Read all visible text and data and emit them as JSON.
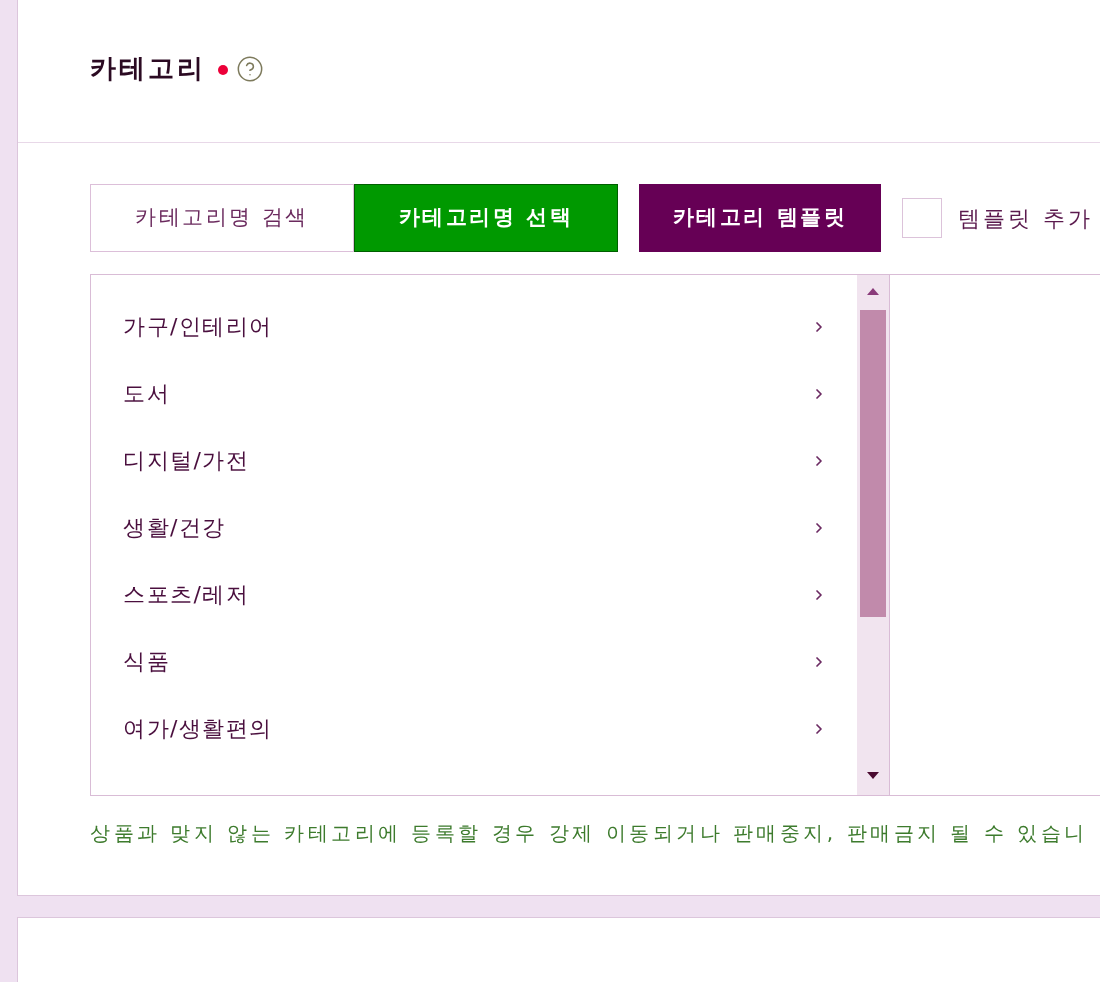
{
  "category_section": {
    "title": "카테고리",
    "required": true,
    "tabs": [
      {
        "label": "카테고리명 검색",
        "selected": false
      },
      {
        "label": "카테고리명 선택",
        "selected": true
      }
    ],
    "template_button": {
      "label": "카테고리 템플릿"
    },
    "template_checkbox": {
      "label": "템플릿 추가",
      "checked": false
    },
    "category_list": {
      "items": [
        {
          "label": "가구/인테리어",
          "selected": false
        },
        {
          "label": "도서",
          "selected": false
        },
        {
          "label": "디지털/가전",
          "selected": false
        },
        {
          "label": "생활/건강",
          "selected": false
        },
        {
          "label": "스포츠/레저",
          "selected": false
        },
        {
          "label": "식품",
          "selected": false
        },
        {
          "label": "여가/생활편의",
          "selected": false
        }
      ]
    },
    "notice": "상품과 맞지 않는 카테고리에 등록할 경우 강제 이동되거나 판매중지, 판매금지 될 수 있습니"
  }
}
